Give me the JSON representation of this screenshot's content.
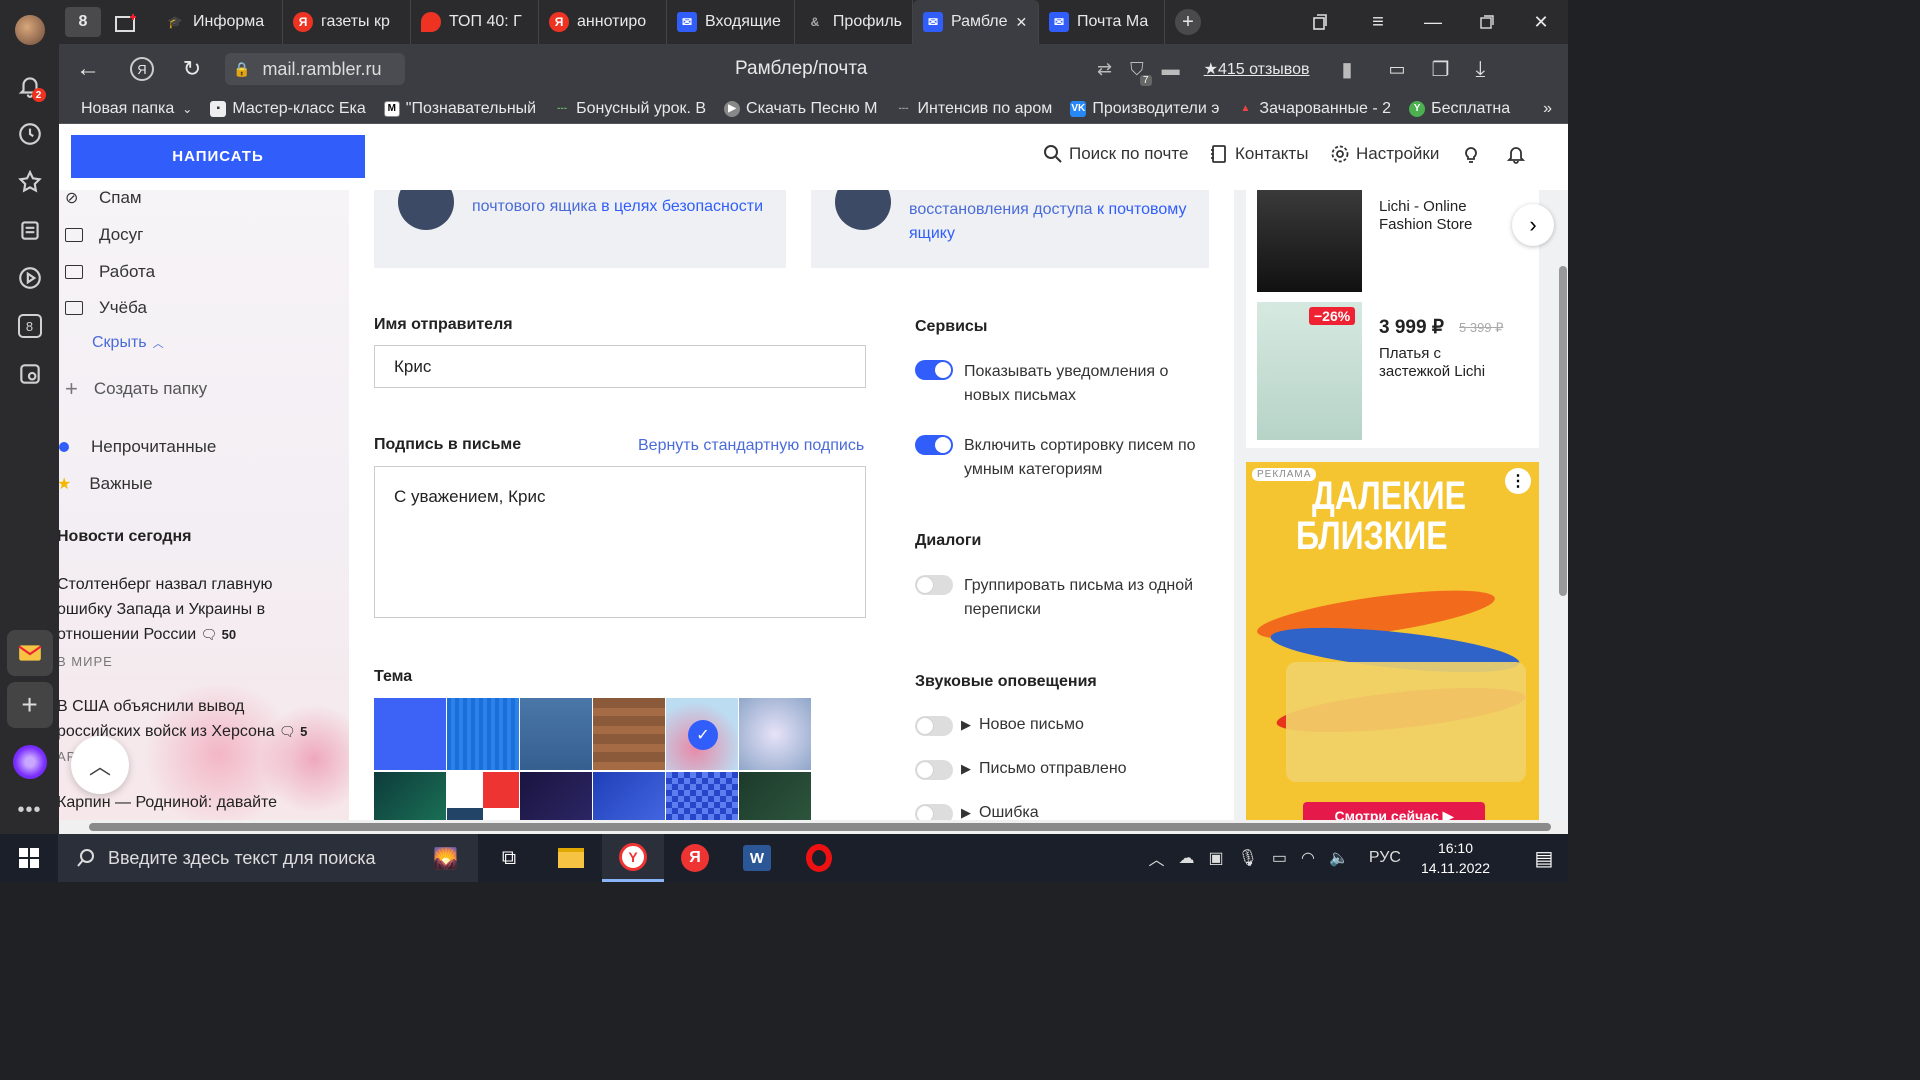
{
  "sidebar": {
    "notifications_badge": "2",
    "tab_count_icon": "8"
  },
  "tabs": {
    "counter": "8",
    "items": [
      {
        "label": "Информа",
        "icon": "graduation-cap-icon"
      },
      {
        "label": "газеты кр",
        "icon": "yandex-icon"
      },
      {
        "label": "ТОП 40: Г",
        "icon": "map-pin-icon"
      },
      {
        "label": "аннотиро",
        "icon": "yandex-icon"
      },
      {
        "label": "Входящие",
        "icon": "mail-icon"
      },
      {
        "label": "Профиль",
        "icon": "link-icon"
      },
      {
        "label": "Рамбле",
        "icon": "mail-icon",
        "active": true
      },
      {
        "label": "Почта Ма",
        "icon": "mail-icon"
      }
    ]
  },
  "address": {
    "url": "mail.rambler.ru",
    "title": "Рамблер/почта",
    "reviews": "★415 отзывов",
    "shield_count": "7"
  },
  "bookmarks": [
    {
      "label": "Новая папка",
      "icon": "folder-icon"
    },
    {
      "label": "Мастер-класс Ека"
    },
    {
      "label": "\"Познавательный"
    },
    {
      "label": "Бонусный урок. В"
    },
    {
      "label": "Скачать Песню М"
    },
    {
      "label": "Интенсив по аром"
    },
    {
      "label": "Производители э"
    },
    {
      "label": "Зачарованные - 2"
    },
    {
      "label": "Бесплатна"
    }
  ],
  "topbar": {
    "compose": "НАПИСАТЬ",
    "search": "Поиск по почте",
    "contacts": "Контакты",
    "settings": "Настройки"
  },
  "folders": {
    "items": [
      "Спам",
      "Досуг",
      "Работа",
      "Учёба"
    ],
    "hide": "Скрыть",
    "create": "Создать папку",
    "unread": "Непрочитанные",
    "important": "Важные"
  },
  "news": {
    "heading": "Новости сегодня",
    "items": [
      {
        "title_lines": [
          "Столтенберг назвал главную",
          "ошибку Запада и Украины в",
          "отношении России"
        ],
        "comments": "50",
        "category": "В МИРЕ"
      },
      {
        "title_lines": [
          "В США объяснили вывод",
          "российских войск из Херсона"
        ],
        "comments": "5",
        "category": "АР"
      },
      {
        "title_lines": [
          "Карпин — Родниной: давайте"
        ]
      }
    ]
  },
  "cards": [
    {
      "line1": "почтового ящика ",
      "link": "в целях безопасности"
    },
    {
      "line1": "восстановления доступа ",
      "link1": "к почтовому",
      "link2": "ящику"
    }
  ],
  "sender": {
    "label": "Имя отправителя",
    "value": "Крис"
  },
  "signature": {
    "label": "Подпись в письме",
    "reset": "Вернуть стандартную подпись",
    "value": "С уважением, Крис"
  },
  "theme": {
    "label": "Тема"
  },
  "services": {
    "heading": "Сервисы",
    "notify": "Показывать уведомления о новых письмах",
    "sort": "Включить сортировку писем по умным категориям"
  },
  "dialogs": {
    "heading": "Диалоги",
    "group": "Группировать письма из одной переписки"
  },
  "sounds": {
    "heading": "Звуковые оповещения",
    "items": [
      "Новое письмо",
      "Письмо отправлено",
      "Ошибка"
    ]
  },
  "ads": {
    "store": "Lichi - Online Fashion Store",
    "discount": "−26%",
    "price": "3 999 ₽",
    "old_price": "5 399 ₽",
    "product": "Платья с застежкой Lichi",
    "ad_label": "РЕКЛАМА",
    "ad_title1": "ДАЛЕКИЕ",
    "ad_title2": "БЛИЗКИЕ",
    "ad_button": "Смотри сейчас ▶"
  },
  "taskbar": {
    "search": "Введите здесь текст для поиска",
    "lang": "РУС",
    "time": "16:10",
    "date": "14.11.2022"
  },
  "colors": {
    "accent": "#315efb",
    "ad_bg": "#f5c431"
  }
}
